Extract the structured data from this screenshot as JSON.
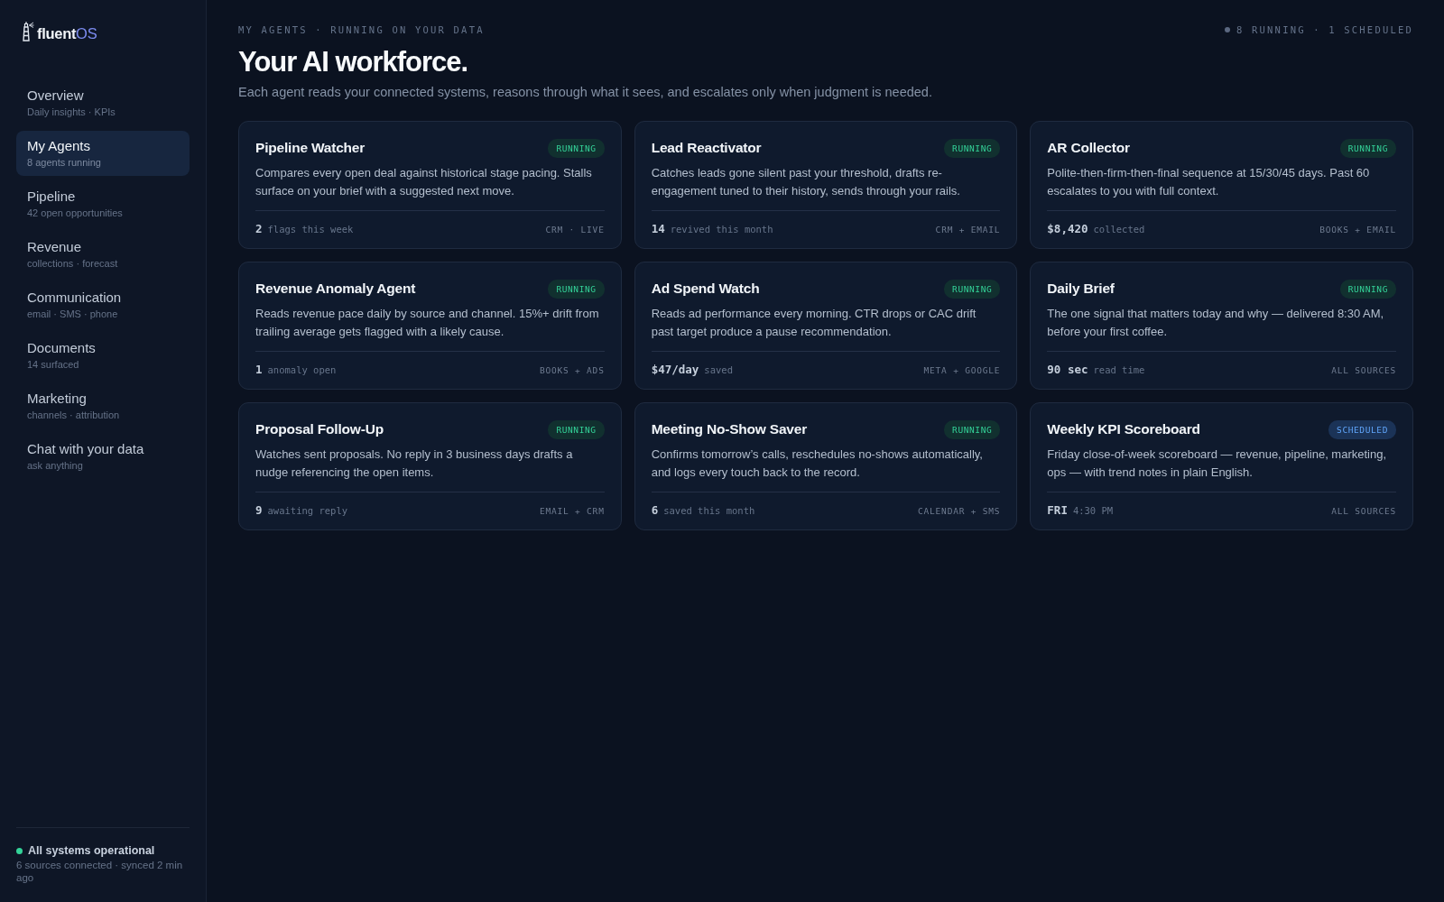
{
  "sidebar": {
    "logo": {
      "name": "fluent",
      "suffix": "OS"
    },
    "items": [
      {
        "label": "Overview",
        "sublabel": "Daily insights · KPIs",
        "selected": false
      },
      {
        "label": "My Agents",
        "sublabel": "8 agents running",
        "selected": true
      },
      {
        "label": "Pipeline",
        "sublabel": "42 open opportunities",
        "selected": false
      },
      {
        "label": "Revenue",
        "sublabel": "collections · forecast",
        "selected": false
      },
      {
        "label": "Communication",
        "sublabel": "email · SMS · phone",
        "selected": false
      },
      {
        "label": "Documents",
        "sublabel": "14 surfaced",
        "selected": false
      },
      {
        "label": "Marketing",
        "sublabel": "channels · attribution",
        "selected": false
      },
      {
        "label": "Chat with your data",
        "sublabel": "ask anything",
        "selected": false
      }
    ],
    "status": {
      "title": "All systems operational",
      "detail": "6 sources connected · synced 2 min ago"
    }
  },
  "header": {
    "eyebrow": "MY AGENTS · RUNNING ON YOUR DATA",
    "summary": "8 RUNNING · 1 SCHEDULED",
    "title": "Your AI workforce.",
    "subtitle": "Each agent reads your connected systems, reasons through what it sees, and escalates only when judgment is needed."
  },
  "agents": [
    {
      "name": "Pipeline Watcher",
      "status": "RUNNING",
      "kind": "running",
      "description": "Compares every open deal against historical stage pacing. Stalls surface on your brief with a suggested next move.",
      "metric_value": "2",
      "metric_label": "flags this week",
      "sources": "CRM · LIVE"
    },
    {
      "name": "Lead Reactivator",
      "status": "RUNNING",
      "kind": "running",
      "description": "Catches leads gone silent past your threshold, drafts re-engagement tuned to their history, sends through your rails.",
      "metric_value": "14",
      "metric_label": "revived this month",
      "sources": "CRM + EMAIL"
    },
    {
      "name": "AR Collector",
      "status": "RUNNING",
      "kind": "running",
      "description": "Polite-then-firm-then-final sequence at 15/30/45 days. Past 60 escalates to you with full context.",
      "metric_value": "$8,420",
      "metric_label": "collected",
      "sources": "BOOKS + EMAIL"
    },
    {
      "name": "Revenue Anomaly Agent",
      "status": "RUNNING",
      "kind": "running",
      "description": "Reads revenue pace daily by source and channel. 15%+ drift from trailing average gets flagged with a likely cause.",
      "metric_value": "1",
      "metric_label": "anomaly open",
      "sources": "BOOKS + ADS"
    },
    {
      "name": "Ad Spend Watch",
      "status": "RUNNING",
      "kind": "running",
      "description": "Reads ad performance every morning. CTR drops or CAC drift past target produce a pause recommendation.",
      "metric_value": "$47/day",
      "metric_label": "saved",
      "sources": "META + GOOGLE"
    },
    {
      "name": "Daily Brief",
      "status": "RUNNING",
      "kind": "running",
      "description": "The one signal that matters today and why — delivered 8:30 AM, before your first coffee.",
      "metric_value": "90 sec",
      "metric_label": "read time",
      "sources": "ALL SOURCES"
    },
    {
      "name": "Proposal Follow-Up",
      "status": "RUNNING",
      "kind": "running",
      "description": "Watches sent proposals. No reply in 3 business days drafts a nudge referencing the open items.",
      "metric_value": "9",
      "metric_label": "awaiting reply",
      "sources": "EMAIL + CRM"
    },
    {
      "name": "Meeting No-Show Saver",
      "status": "RUNNING",
      "kind": "running",
      "description": "Confirms tomorrow’s calls, reschedules no-shows automatically, and logs every touch back to the record.",
      "metric_value": "6",
      "metric_label": "saved this month",
      "sources": "CALENDAR + SMS"
    },
    {
      "name": "Weekly KPI Scoreboard",
      "status": "SCHEDULED",
      "kind": "scheduled",
      "description": "Friday close-of-week scoreboard — revenue, pipeline, marketing, ops — with trend notes in plain English.",
      "metric_value": "FRI",
      "metric_label": "4:30 PM",
      "sources": "ALL SOURCES"
    }
  ]
}
